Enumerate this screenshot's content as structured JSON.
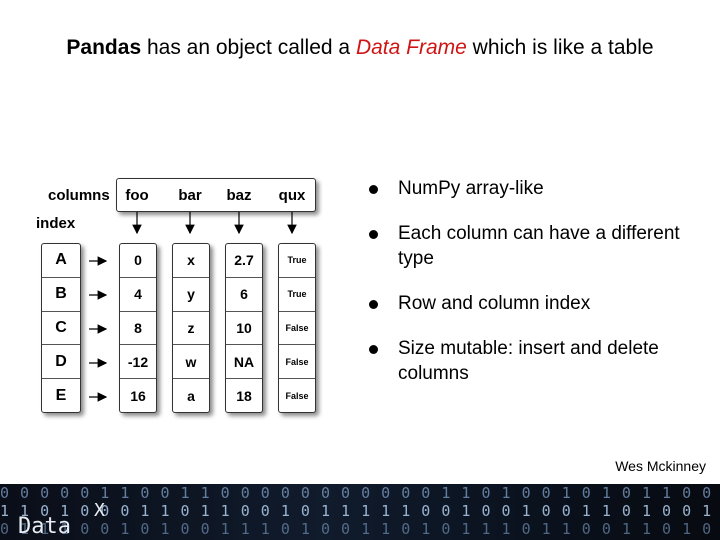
{
  "slide": {
    "title_bold": "Pandas",
    "title_mid": " has an object called a ",
    "title_emph": "Data Frame",
    "title_end": " which is like a table",
    "credit": "Wes Mckinney"
  },
  "dataframe": {
    "columns_label": "columns",
    "index_label": "index",
    "column_names": [
      "foo",
      "bar",
      "baz",
      "qux"
    ],
    "index": [
      "A",
      "B",
      "C",
      "D",
      "E"
    ],
    "columns": [
      [
        "0",
        "4",
        "8",
        "-12",
        "16"
      ],
      [
        "x",
        "y",
        "z",
        "w",
        "a"
      ],
      [
        "2.7",
        "6",
        "10",
        "NA",
        "18"
      ],
      [
        "True",
        "True",
        "False",
        "False",
        "False"
      ]
    ]
  },
  "bullets": [
    "NumPy array-like",
    "Each column can have a different type",
    "Row and column index",
    "Size mutable: insert and delete columns"
  ],
  "banner": {
    "brand": "Data",
    "brand_sup": "X",
    "rows": [
      "0 0  0 0 0 1 1 0  0 1 1 0 0 0 0  0 0 0 0 0 0 0 1 1 0  1  0 0 1 0 1 0 1 1 0 0",
      "1 1 0  1 0 0 0  1 1 0 1 1 0 0 1 0  1 1 1 1 1 0 0  1  0 0 1 0 0 1 1 0 1 0 0 1 1",
      "0 1  1 1 0 0 1 0  1 0 0 1 1 1 0 1  0 0 1 1 0 1 0 1 1  1 0 1 1 0 0 1 1 0 1 0"
    ]
  },
  "colors": {
    "emphasis": "#d01414"
  }
}
